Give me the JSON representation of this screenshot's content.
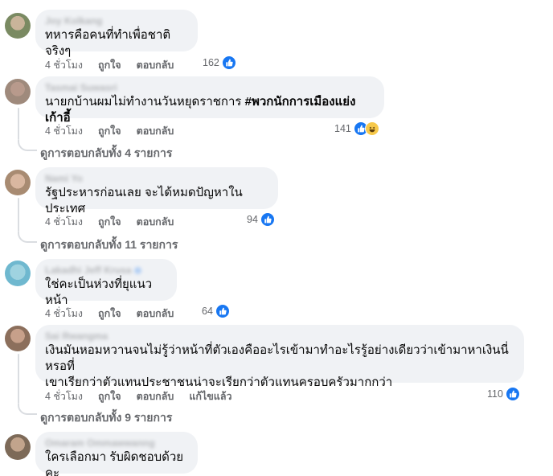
{
  "comments": [
    {
      "author": "Joy Kolkang",
      "text": "ทหารคือคนที่ทำเพื่อชาติจริงๆ",
      "time": "4 ชั่วโมง",
      "like_label": "ถูกใจ",
      "reply_label": "ตอบกลับ",
      "reaction_count": "162",
      "reactions": [
        "like"
      ]
    },
    {
      "author": "Tasmai Suwasri",
      "text": "นายกบ้านผมไม่ทำงานวันหยุดราชการ ",
      "hashtag": "#พวกนักการเมืองแย่งเก้าอี้",
      "time": "4 ชั่วโมง",
      "like_label": "ถูกใจ",
      "reply_label": "ตอบกลับ",
      "reaction_count": "141",
      "reactions": [
        "like",
        "haha"
      ],
      "view_replies": "ดูการตอบกลับทั้ง 4 รายการ"
    },
    {
      "author": "Nami Yo",
      "text": "รัฐประหารก่อนเลย จะได้หมดปัญหาในประเทศ",
      "time": "4 ชั่วโมง",
      "like_label": "ถูกใจ",
      "reply_label": "ตอบกลับ",
      "reaction_count": "94",
      "reactions": [
        "like"
      ],
      "view_replies": "ดูการตอบกลับทั้ง 11 รายการ"
    },
    {
      "author": "Lakadhi Jeff Krusa",
      "text": "ใช่คะเป็นห่วงที่ยุแนวหน้า",
      "time": "4 ชั่วโมง",
      "like_label": "ถูกใจ",
      "reply_label": "ตอบกลับ",
      "reaction_count": "64",
      "reactions": [
        "like"
      ]
    },
    {
      "author": "Sai Rwangma",
      "text": "เงินมันหอมหวานจนไม่รู้ว่าหน้าที่ตัวเองคืออะไรเข้ามาทำอะไรรู้อย่างเดียวว่าเข้ามาหาเงินนี่หรอที่\nเขาเรียกว่าตัวแทนประชาชนน่าจะเรียกว่าตัวแทนครอบครัวมากกว่า",
      "time": "4 ชั่วโมง",
      "like_label": "ถูกใจ",
      "reply_label": "ตอบกลับ",
      "edited_label": "แก้ไขแล้ว",
      "reaction_count": "110",
      "reactions": [
        "like"
      ],
      "view_replies": "ดูการตอบกลับทั้ง 9 รายการ"
    },
    {
      "author": "Omaram Ommawwanng",
      "text": "ใครเลือกมา รับผิดชอบด้วยคะ"
    }
  ],
  "colors": {
    "bubble": "#f0f2f5",
    "meta_text": "#65676b",
    "like_blue": "#1877f2",
    "haha_yellow": "#f7c94a"
  }
}
